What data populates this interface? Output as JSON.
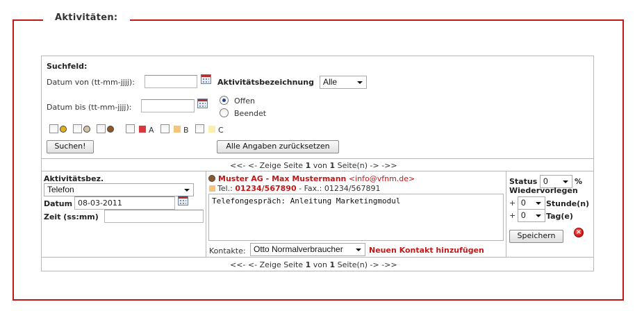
{
  "legend": "Aktivitäten:",
  "search": {
    "title": "Suchfeld:",
    "date_from_label": "Datum von (tt-mm-jjjj):",
    "date_from_value": "",
    "date_to_label": "Datum bis (tt-mm-jjjj):",
    "date_to_value": "",
    "activity_label": "Aktivitätsbezeichnung",
    "activity_selected": "Alle",
    "status_options": [
      {
        "label": "Offen",
        "selected": true
      },
      {
        "label": "Beendet",
        "selected": false
      }
    ],
    "filters": {
      "dots": [
        {
          "color": "#e0b11a",
          "checked": false
        },
        {
          "color": "#cfc4a6",
          "checked": false
        },
        {
          "color": "#8b5a2b",
          "checked": false
        }
      ],
      "priorities": [
        {
          "label": "A",
          "color": "#d9393b"
        },
        {
          "label": "B",
          "color": "#f6c47a"
        },
        {
          "label": "C",
          "color": "#fbefb0"
        }
      ]
    },
    "search_button": "Suchen!",
    "reset_button": "Alle Angaben zurücksetzen"
  },
  "pager_top": {
    "prefix": "<<- <- Zeige Seite",
    "page": "1",
    "middle": "von",
    "total": "1",
    "suffix": "Seite(n) -> ->>"
  },
  "pager_bottom": {
    "prefix": "<<- <- Zeige Seite",
    "page": "1",
    "middle": "von",
    "total": "1",
    "suffix": "Seite(n) -> ->>"
  },
  "entry": {
    "type_label": "Aktivitätsbez.",
    "type_value": "Telefon",
    "date_label": "Datum",
    "date_value": "08-03-2011",
    "time_label": "Zeit (ss:mm)",
    "time_value": "",
    "contact_company": "Muster AG - Max Mustermann",
    "contact_email": "<info@vfnm.de>",
    "phone_label": "Tel.:",
    "phone_value": "01234/567890",
    "fax_text": "- Fax.: 01234/567891",
    "note_text": "Telefongespräch: Anleitung Marketingmodul",
    "contacts_label": "Kontakte:",
    "contacts_selected": "Otto Normalverbraucher",
    "add_contact": "Neuen Kontakt hinzufügen",
    "status_label": "Status",
    "status_value": "0",
    "percent": "%",
    "resubmit_label": "Wiedervorlegen",
    "plus": "+",
    "hours_value": "0",
    "hours_label": "Stunde(n)",
    "days_value": "0",
    "days_label": "Tag(e)",
    "save_button": "Speichern",
    "close_symbol": "×",
    "dot_color": "#8b5a2b",
    "phone_square_color": "#f6c47a"
  }
}
